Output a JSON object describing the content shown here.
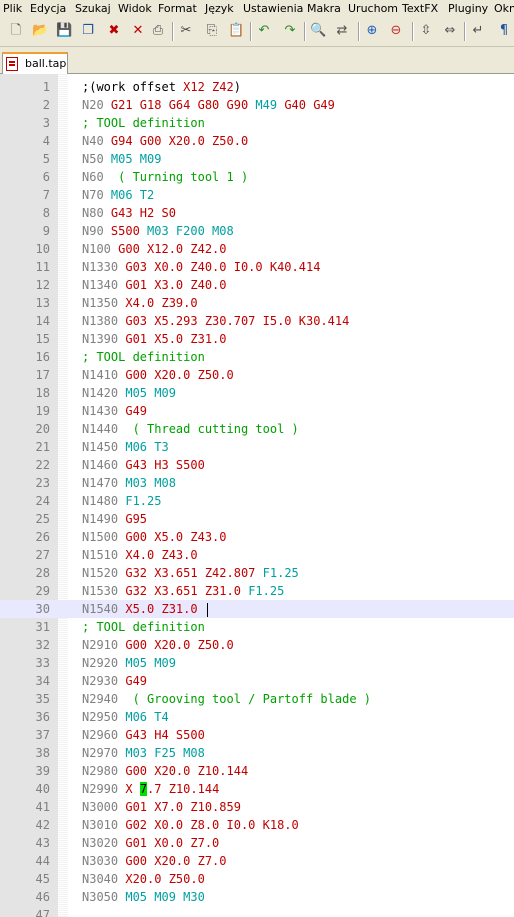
{
  "menu": [
    "Plik",
    "Edycja",
    "Szukaj",
    "Widok",
    "Format",
    "Język",
    "Ustawienia",
    "Makra",
    "Uruchom",
    "TextFX",
    "Pluginy",
    "Okno"
  ],
  "toolbar": [
    "new-file-icon",
    "open-file-icon",
    "save-icon",
    "save-all-icon",
    "close-icon",
    "close-all-icon",
    "print-icon",
    "cut-icon",
    "copy-icon",
    "paste-icon",
    "undo-icon",
    "redo-icon",
    "find-icon",
    "replace-icon",
    "zoom-in-icon",
    "zoom-out-icon",
    "sync-v-icon",
    "sync-h-icon",
    "wrap-icon",
    "show-all-icon"
  ],
  "tab": {
    "label": "ball.tap"
  },
  "colors": {
    "gcode": "#c00000",
    "mcode": "#00a0a0",
    "comment": "#00a000",
    "linenumber": "#808080",
    "current_line": "#e8e8ff"
  },
  "current_line": 30,
  "lines": [
    [
      [
        ";(work offset ",
        "plain"
      ],
      [
        "X12 Z42",
        "axis"
      ],
      [
        ")",
        "plain"
      ]
    ],
    [
      [
        "N20 ",
        "nnum"
      ],
      [
        "G21 G18 G64 G80 G90 ",
        "gcode"
      ],
      [
        "M49 ",
        "mcode"
      ],
      [
        "G40 G49",
        "gcode"
      ]
    ],
    [
      [
        "; TOOL definition",
        "comment"
      ]
    ],
    [
      [
        "N40 ",
        "nnum"
      ],
      [
        "G94 G00 X20.0 Z50.0",
        "gcode"
      ]
    ],
    [
      [
        "N50 ",
        "nnum"
      ],
      [
        "M05 M09",
        "mcode"
      ]
    ],
    [
      [
        "N60  ",
        "nnum"
      ],
      [
        "( Turning tool 1 )",
        "comment"
      ]
    ],
    [
      [
        "N70 ",
        "nnum"
      ],
      [
        "M06 T2",
        "mcode"
      ]
    ],
    [
      [
        "N80 ",
        "nnum"
      ],
      [
        "G43 H2 S0",
        "gcode"
      ]
    ],
    [
      [
        "N90 ",
        "nnum"
      ],
      [
        "S500 ",
        "gcode"
      ],
      [
        "M03 F200 M08",
        "mcode"
      ]
    ],
    [
      [
        "N100 ",
        "nnum"
      ],
      [
        "G00 X12.0 Z42.0",
        "gcode"
      ]
    ],
    [
      [
        "N1330 ",
        "nnum"
      ],
      [
        "G03 X0.0 Z40.0 I0.0 K40.414",
        "gcode"
      ]
    ],
    [
      [
        "N1340 ",
        "nnum"
      ],
      [
        "G01 X3.0 Z40.0",
        "gcode"
      ]
    ],
    [
      [
        "N1350 ",
        "nnum"
      ],
      [
        "X4.0 Z39.0",
        "gcode"
      ]
    ],
    [
      [
        "N1380 ",
        "nnum"
      ],
      [
        "G03 X5.293 Z30.707 I5.0 K30.414",
        "gcode"
      ]
    ],
    [
      [
        "N1390 ",
        "nnum"
      ],
      [
        "G01 X5.0 Z31.0",
        "gcode"
      ]
    ],
    [
      [
        "; TOOL definition",
        "comment"
      ]
    ],
    [
      [
        "N1410 ",
        "nnum"
      ],
      [
        "G00 X20.0 Z50.0",
        "gcode"
      ]
    ],
    [
      [
        "N1420 ",
        "nnum"
      ],
      [
        "M05 M09",
        "mcode"
      ]
    ],
    [
      [
        "N1430 ",
        "nnum"
      ],
      [
        "G49",
        "gcode"
      ]
    ],
    [
      [
        "N1440  ",
        "nnum"
      ],
      [
        "( Thread cutting tool )",
        "comment"
      ]
    ],
    [
      [
        "N1450 ",
        "nnum"
      ],
      [
        "M06 T3",
        "mcode"
      ]
    ],
    [
      [
        "N1460 ",
        "nnum"
      ],
      [
        "G43 H3 S500",
        "gcode"
      ]
    ],
    [
      [
        "N1470 ",
        "nnum"
      ],
      [
        "M03 M08",
        "mcode"
      ]
    ],
    [
      [
        "N1480 ",
        "nnum"
      ],
      [
        "F1.25",
        "mcode"
      ]
    ],
    [
      [
        "N1490 ",
        "nnum"
      ],
      [
        "G95",
        "gcode"
      ]
    ],
    [
      [
        "N1500 ",
        "nnum"
      ],
      [
        "G00 X5.0 Z43.0",
        "gcode"
      ]
    ],
    [
      [
        "N1510 ",
        "nnum"
      ],
      [
        "X4.0 Z43.0",
        "gcode"
      ]
    ],
    [
      [
        "N1520 ",
        "nnum"
      ],
      [
        "G32 X3.651 Z42.807 ",
        "gcode"
      ],
      [
        "F1.25",
        "mcode"
      ]
    ],
    [
      [
        "N1530 ",
        "nnum"
      ],
      [
        "G32 X3.651 Z31.0 ",
        "gcode"
      ],
      [
        "F1.25",
        "mcode"
      ]
    ],
    [
      [
        "N1540 ",
        "nnum"
      ],
      [
        "X5.0 Z31.0 ",
        "gcode"
      ]
    ],
    [
      [
        "; TOOL definition",
        "comment"
      ]
    ],
    [
      [
        "N2910 ",
        "nnum"
      ],
      [
        "G00 X20.0 Z50.0",
        "gcode"
      ]
    ],
    [
      [
        "N2920 ",
        "nnum"
      ],
      [
        "M05 M09",
        "mcode"
      ]
    ],
    [
      [
        "N2930 ",
        "nnum"
      ],
      [
        "G49",
        "gcode"
      ]
    ],
    [
      [
        "N2940  ",
        "nnum"
      ],
      [
        "( Grooving tool / Partoff blade )",
        "comment"
      ]
    ],
    [
      [
        "N2950 ",
        "nnum"
      ],
      [
        "M06 T4",
        "mcode"
      ]
    ],
    [
      [
        "N2960 ",
        "nnum"
      ],
      [
        "G43 H4 S500",
        "gcode"
      ]
    ],
    [
      [
        "N2970 ",
        "nnum"
      ],
      [
        "M03 F25 M08",
        "mcode"
      ]
    ],
    [
      [
        "N2980 ",
        "nnum"
      ],
      [
        "G00 X20.0 Z10.144",
        "gcode"
      ]
    ],
    [
      [
        "N2990 ",
        "nnum"
      ],
      [
        "X ",
        "gcode"
      ],
      [
        "7",
        "hl"
      ],
      [
        ".7 Z10.144",
        "gcode"
      ]
    ],
    [
      [
        "N3000 ",
        "nnum"
      ],
      [
        "G01 X7.0 Z10.859",
        "gcode"
      ]
    ],
    [
      [
        "N3010 ",
        "nnum"
      ],
      [
        "G02 X0.0 Z8.0 I0.0 K18.0",
        "gcode"
      ]
    ],
    [
      [
        "N3020 ",
        "nnum"
      ],
      [
        "G01 X0.0 Z7.0",
        "gcode"
      ]
    ],
    [
      [
        "N3030 ",
        "nnum"
      ],
      [
        "G00 X20.0 Z7.0",
        "gcode"
      ]
    ],
    [
      [
        "N3040 ",
        "nnum"
      ],
      [
        "X20.0 Z50.0",
        "gcode"
      ]
    ],
    [
      [
        "N3050 ",
        "nnum"
      ],
      [
        "M05 M09 M30",
        "mcode"
      ]
    ],
    []
  ]
}
